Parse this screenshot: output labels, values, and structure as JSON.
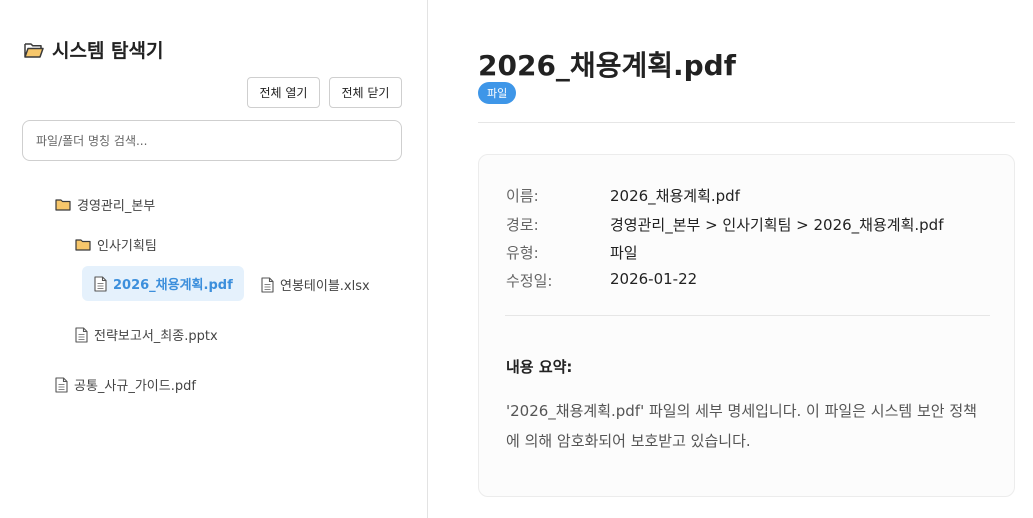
{
  "sidebar": {
    "title": "시스템 탐색기",
    "expand_all": "전체 열기",
    "collapse_all": "전체 닫기",
    "search_placeholder": "파일/폴더 명칭 검색...",
    "tree": {
      "root_folder": "경영관리_본부",
      "sub_folder": "인사기획팀",
      "file_selected": "2026_채용계획.pdf",
      "file_sibling": "연봉테이블.xlsx",
      "file_report": "전략보고서_최종.pptx",
      "file_guide": "공통_사규_가이드.pdf"
    }
  },
  "detail": {
    "title": "2026_채용계획.pdf",
    "type_badge": "파일",
    "meta": [
      {
        "key": "이름:",
        "value": "2026_채용계획.pdf"
      },
      {
        "key": "경로:",
        "value": "경영관리_본부 > 인사기획팀 > 2026_채용계획.pdf"
      },
      {
        "key": "유형:",
        "value": "파일"
      },
      {
        "key": "수정일:",
        "value": "2026-01-22"
      }
    ],
    "summary_title": "내용 요약:",
    "summary_text": "'2026_채용계획.pdf' 파일의 세부 명세입니다. 이 파일은 시스템 보안 정책에 의해 암호화되어 보호받고 있습니다."
  },
  "colors": {
    "accent": "#3e96e8",
    "selected_bg": "#e5f1fc",
    "folder_fill": "#f7c76b",
    "folder_stroke": "#3a3a3a"
  },
  "icons": {
    "title": "folder-open-icon",
    "folder": "folder-icon",
    "file": "file-icon"
  }
}
